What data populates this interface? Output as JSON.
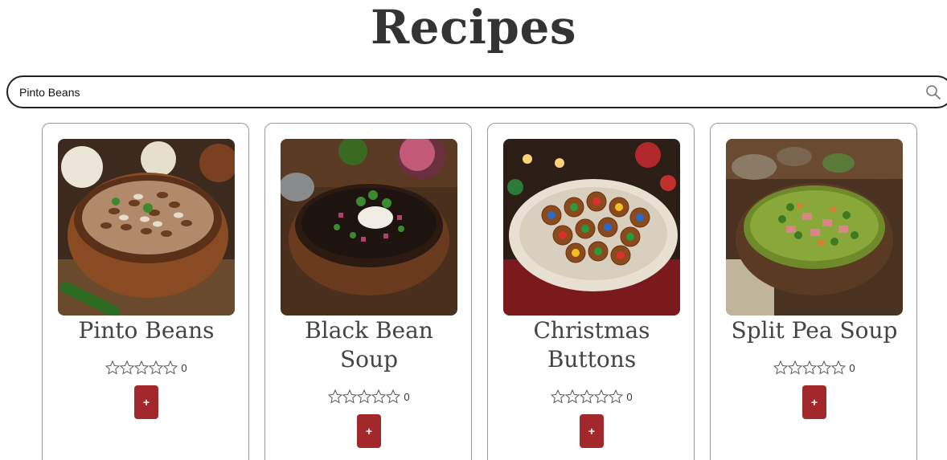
{
  "page": {
    "title": "Recipes"
  },
  "search": {
    "value": "Pinto Beans",
    "icon": "search-icon"
  },
  "colors": {
    "accent": "#a3282c",
    "border": "#222222",
    "card_border": "#9a9a9a"
  },
  "recipes": [
    {
      "title": "Pinto Beans",
      "rating": "0",
      "add_label": "+",
      "image": "bowl-of-pinto-beans"
    },
    {
      "title": "Black Bean Soup",
      "rating": "0",
      "add_label": "+",
      "image": "bowl-of-black-bean-soup"
    },
    {
      "title": "Christmas Buttons",
      "rating": "0",
      "add_label": "+",
      "image": "plate-of-pretzel-candy-buttons"
    },
    {
      "title": "Split Pea Soup",
      "rating": "0",
      "add_label": "+",
      "image": "bowl-of-split-pea-soup"
    }
  ]
}
